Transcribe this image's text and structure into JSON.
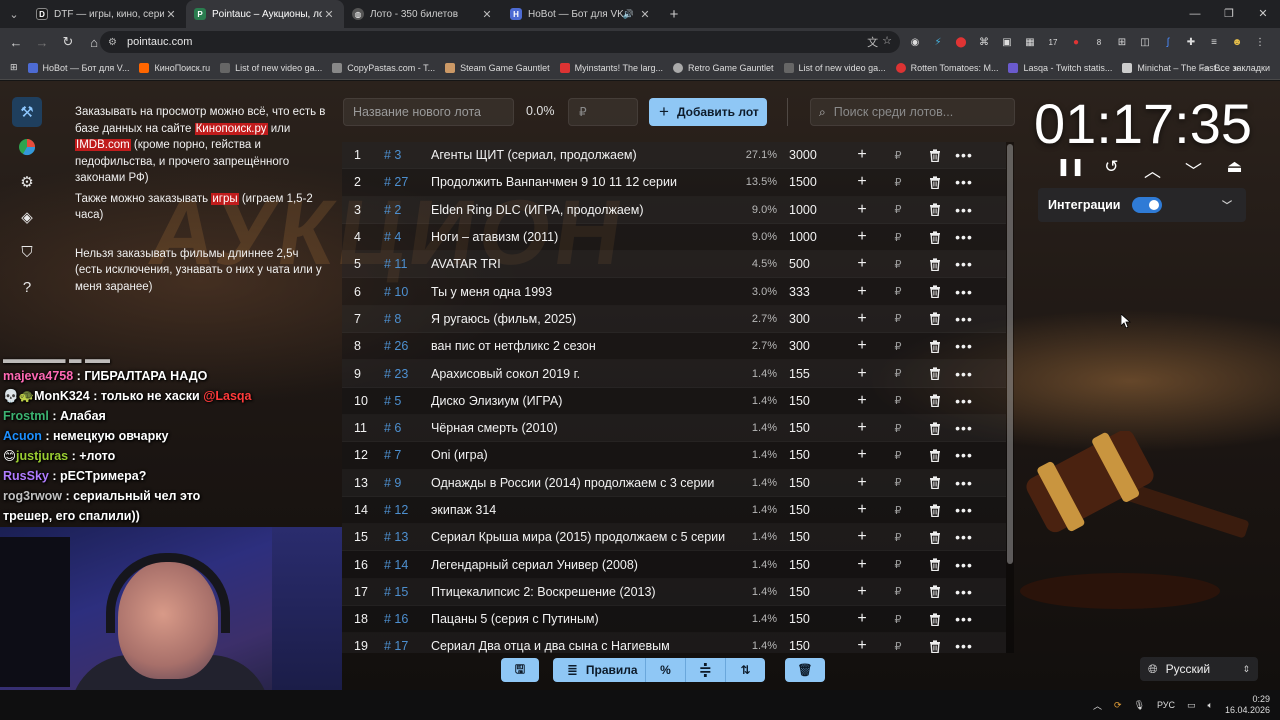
{
  "browser": {
    "tabs": [
      {
        "title": "DTF — игры, кино, сериалы, р",
        "active": false
      },
      {
        "title": "Pointauc – Аукционы, лотерей",
        "active": true
      },
      {
        "title": "Лото - 350 билетов",
        "active": false
      },
      {
        "title": "HoBot — Бот для VK Video",
        "active": false,
        "audio": true
      }
    ],
    "address": "pointauc.com",
    "bookmarks": [
      "HoBot — Бот для V...",
      "КиноПоиск.ru",
      "List of new video ga...",
      "CopyPastas.com - T...",
      "Steam Game Gauntlet",
      "Myinstants! The larg...",
      "Retro Game Gauntlet",
      "List of new video ga...",
      "Rotten Tomatoes: M...",
      "Lasqa - Twitch statis...",
      "Minichat – The Fast..."
    ],
    "all_bookmarks": "Все закладки",
    "ext_badges": {
      "b1": "17",
      "b2": "8"
    }
  },
  "info": {
    "p1_a": "Заказывать на просмотр можно всё, что есть в базе данных на сайте ",
    "p1_link1": "Кинопоиск.ру",
    "p1_b": " или ",
    "p1_link2": "IMDB.com",
    "p1_c": " (кроме порно, гейства и педофильства, и прочего запрещённого законами РФ)",
    "p2_a": "Также можно заказывать ",
    "p2_link": "игры",
    "p2_b": " (играем 1,5-2 часа)",
    "p3": "Нельзя заказывать фильмы длиннее 2,5ч (есть исключения, узнавать о них у чата или у меня заранее)"
  },
  "chat": [
    {
      "user": "majeva4758",
      "color": "#ff69b4",
      "text": "ГИБРАЛТАРА НАДО",
      "icon": ""
    },
    {
      "user": "MonK324",
      "color": "#ffffff",
      "text": "только не хаски ",
      "mention": "@Lasqa",
      "icon": "💀🐢"
    },
    {
      "user": "Frostml",
      "color": "#3cb371",
      "text": "Алабая",
      "icon": ""
    },
    {
      "user": "Acuon",
      "color": "#1e90ff",
      "text": "немецкую овчарку",
      "icon": ""
    },
    {
      "user": "justjuras",
      "color": "#9acd32",
      "text": "+лото",
      "icon": "😊"
    },
    {
      "user": "RusSky",
      "color": "#b07cff",
      "text": "pECTримера?",
      "icon": ""
    },
    {
      "user": "rog3rwow",
      "color": "#c0c0c0",
      "text": "сериальный чел это",
      "icon": ""
    },
    {
      "user": "",
      "color": "#ffffff",
      "text": "трешер, его спалили))",
      "icon": ""
    }
  ],
  "controls": {
    "lot_placeholder": "Название нового лота",
    "percent": "0.0%",
    "amount_placeholder": "₽",
    "add_label": "Добавить лот",
    "search_placeholder": "Поиск среди лотов..."
  },
  "lots": [
    {
      "n": "1",
      "id": "# 3",
      "name": "Агенты ЩИТ (сериал, продолжаем)",
      "pct": "27.1%",
      "amount": "3000"
    },
    {
      "n": "2",
      "id": "# 27",
      "name": "Продолжить Ванпанчмен 9 10 11 12 серии",
      "pct": "13.5%",
      "amount": "1500"
    },
    {
      "n": "3",
      "id": "# 2",
      "name": "Elden Ring DLC (ИГРА, продолжаем)",
      "pct": "9.0%",
      "amount": "1000"
    },
    {
      "n": "4",
      "id": "# 4",
      "name": "Ноги – атавизм (2011)",
      "pct": "9.0%",
      "amount": "1000"
    },
    {
      "n": "5",
      "id": "# 11",
      "name": "AVATAR TRI",
      "pct": "4.5%",
      "amount": "500"
    },
    {
      "n": "6",
      "id": "# 10",
      "name": "Ты у меня одна 1993",
      "pct": "3.0%",
      "amount": "333"
    },
    {
      "n": "7",
      "id": "# 8",
      "name": "Я ругаюсь (фильм, 2025)",
      "pct": "2.7%",
      "amount": "300"
    },
    {
      "n": "8",
      "id": "# 26",
      "name": "ван пис от нетфликс 2 сезон",
      "pct": "2.7%",
      "amount": "300"
    },
    {
      "n": "9",
      "id": "# 23",
      "name": "Арахисовый сокол 2019 г.",
      "pct": "1.4%",
      "amount": "155"
    },
    {
      "n": "10",
      "id": "# 5",
      "name": "Диско Элизиум (ИГРА)",
      "pct": "1.4%",
      "amount": "150"
    },
    {
      "n": "11",
      "id": "# 6",
      "name": "Чёрная смерть (2010)",
      "pct": "1.4%",
      "amount": "150"
    },
    {
      "n": "12",
      "id": "# 7",
      "name": "Oni (игра)",
      "pct": "1.4%",
      "amount": "150"
    },
    {
      "n": "13",
      "id": "# 9",
      "name": "Однажды в России (2014) продолжаем с 3 серии",
      "pct": "1.4%",
      "amount": "150"
    },
    {
      "n": "14",
      "id": "# 12",
      "name": "экипаж 314",
      "pct": "1.4%",
      "amount": "150"
    },
    {
      "n": "15",
      "id": "# 13",
      "name": "Сериал Крыша мира (2015) продолжаем с 5 серии",
      "pct": "1.4%",
      "amount": "150"
    },
    {
      "n": "16",
      "id": "# 14",
      "name": "Легендарный сериал Универ (2008)",
      "pct": "1.4%",
      "amount": "150"
    },
    {
      "n": "17",
      "id": "# 15",
      "name": "Птицекалипсис 2: Воскрешение (2013)",
      "pct": "1.4%",
      "amount": "150"
    },
    {
      "n": "18",
      "id": "# 16",
      "name": "Пацаны 5 (серия с Путиным)",
      "pct": "1.4%",
      "amount": "150"
    },
    {
      "n": "19",
      "id": "# 17",
      "name": "Сериал Два отца и два сына с Нагиевым",
      "pct": "1.4%",
      "amount": "150"
    }
  ],
  "row_currency": "₽",
  "bottom": {
    "rules_label": "Правила",
    "percent_icon": "%"
  },
  "timer": "01:17:35",
  "integrations": "Интеграции",
  "language": "Русский",
  "taskbar": {
    "lang": "РУС",
    "time": "0:29",
    "date": "16.04.2026"
  }
}
